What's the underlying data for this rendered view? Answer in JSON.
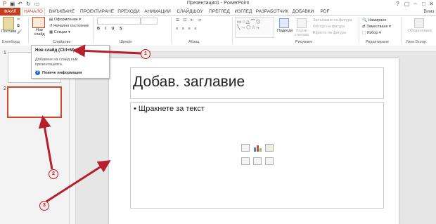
{
  "window": {
    "title": "Презентация1 - PowerPoint",
    "user": "Влиз"
  },
  "tabs": [
    "ФАЙЛ",
    "НАЧАЛО",
    "ВМЪКВАНЕ",
    "ПРОЕКТИРАНЕ",
    "ПРЕХОДИ",
    "АНИМАЦИИ",
    "СЛАЙДШОУ",
    "ПРЕГЛЕД",
    "ИЗГЛЕД",
    "РАЗРАБОТЧИК",
    "ДОБАВКИ",
    "PDF"
  ],
  "ribbon": {
    "clipboard": {
      "paste": "Постави",
      "group": "Клипборд"
    },
    "slides": {
      "new_slide": "Нов слайд",
      "layout": "Оформление",
      "reset": "Начално състояние",
      "section": "Секции",
      "group": "Слайдове"
    },
    "font": {
      "group": "Шрифт"
    },
    "paragraph": {
      "group": "Абзац"
    },
    "drawing": {
      "arrange": "Подреди",
      "quick_styles": "Бързи стилове",
      "fill": "Запълване на фигура",
      "outline": "Контур на фигура",
      "effects": "Ефекти на фигура",
      "group": "Рисуване"
    },
    "editing": {
      "find": "Намиране",
      "replace": "Заместване",
      "select": "Избор",
      "group": "Редактиране"
    },
    "new_group": {
      "combine": "Обединяване",
      "group": "New Group"
    }
  },
  "tooltip": {
    "title": "Нов слайд (Ctrl+M)",
    "description": "Добавяне на слайд към презентацията.",
    "more": "Повече информация"
  },
  "thumbnails": [
    "1",
    "2"
  ],
  "slide": {
    "title_placeholder": "Добав. заглавие",
    "body_placeholder": "• Щракнете за текст"
  },
  "callouts": [
    "1",
    "2",
    "3"
  ],
  "colors": {
    "accent": "#c43e1c",
    "annotation": "#b51f2e"
  }
}
